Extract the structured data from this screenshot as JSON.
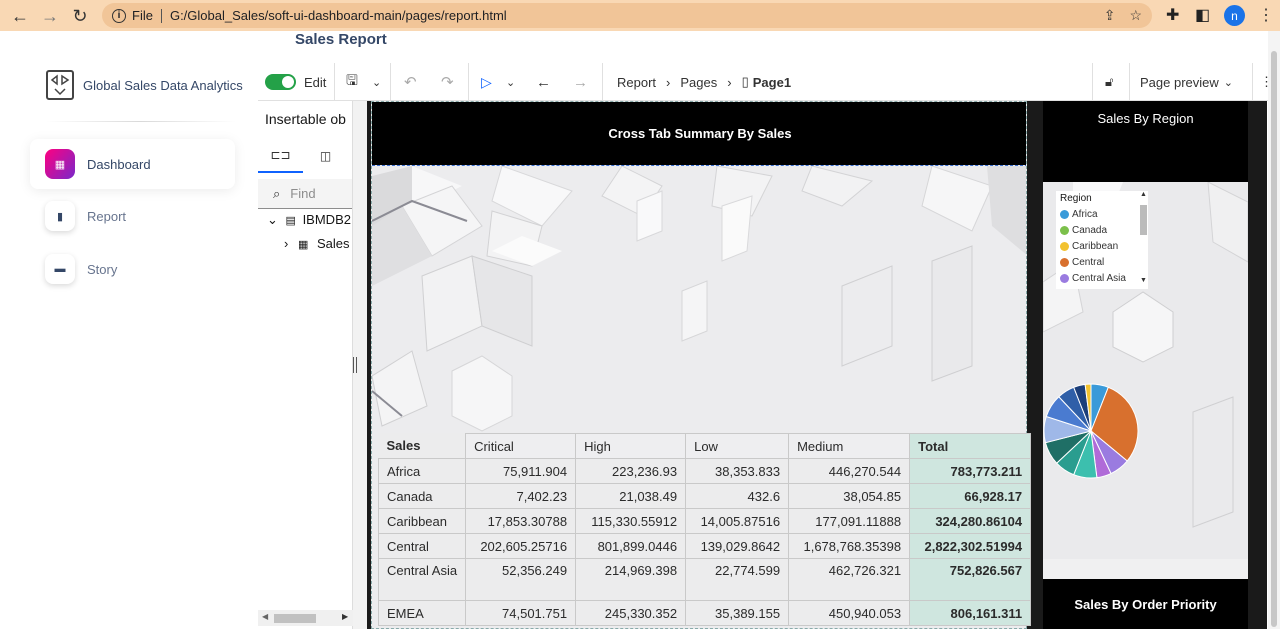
{
  "browser": {
    "url_scheme": "File",
    "url": "G:/Global_Sales/soft-ui-dashboard-main/pages/report.html",
    "avatar_letter": "n"
  },
  "page": {
    "title": "Sales Report"
  },
  "sidebar": {
    "brand": "Global Sales Data Analytics",
    "items": [
      {
        "label": "Dashboard",
        "icon": "shop-icon",
        "active": true
      },
      {
        "label": "Report",
        "icon": "chart-bar-icon",
        "active": false
      },
      {
        "label": "Story",
        "icon": "credit-card-icon",
        "active": false
      }
    ]
  },
  "toolbar": {
    "edit_label": "Edit",
    "breadcrumb": [
      "Report",
      "Pages",
      "Page1"
    ],
    "page_preview": "Page preview"
  },
  "insertable": {
    "title": "Insertable ob",
    "find_placeholder": "Find",
    "tree": [
      {
        "label": "IBMDB2",
        "icon": "database-icon",
        "expanded": true
      },
      {
        "label": "Sales",
        "icon": "table-icon",
        "expanded": false
      }
    ]
  },
  "canvas": {
    "crosstab_title": "Cross Tab Summary By Sales",
    "region_title": "Sales By Region",
    "priority_title": "Sales By Order Priority",
    "legend": {
      "title": "Region",
      "items": [
        {
          "label": "Africa",
          "color": "#3a9ad9"
        },
        {
          "label": "Canada",
          "color": "#7cc04b"
        },
        {
          "label": "Caribbean",
          "color": "#f2c230"
        },
        {
          "label": "Central",
          "color": "#d8702e"
        },
        {
          "label": "Central Asia",
          "color": "#9a7be0"
        }
      ]
    }
  },
  "crosstab": {
    "corner": "Sales",
    "columns": [
      "Critical",
      "High",
      "Low",
      "Medium",
      "Total"
    ],
    "rows": [
      {
        "label": "Africa",
        "values": [
          "75,911.904",
          "223,236.93",
          "38,353.833",
          "446,270.544",
          "783,773.211"
        ]
      },
      {
        "label": "Canada",
        "values": [
          "7,402.23",
          "21,038.49",
          "432.6",
          "38,054.85",
          "66,928.17"
        ]
      },
      {
        "label": "Caribbean",
        "values": [
          "17,853.30788",
          "115,330.55912",
          "14,005.87516",
          "177,091.11888",
          "324,280.86104"
        ]
      },
      {
        "label": "Central",
        "values": [
          "202,605.25716",
          "801,899.0446",
          "139,029.8642",
          "1,678,768.35398",
          "2,822,302.51994"
        ]
      },
      {
        "label": "Central Asia",
        "values": [
          "52,356.249",
          "214,969.398",
          "22,774.599",
          "462,726.321",
          "752,826.567"
        ]
      },
      {
        "label": "EMEA",
        "values": [
          "74,501.751",
          "245,330.352",
          "35,389.155",
          "450,940.053",
          "806,161.311"
        ]
      }
    ]
  },
  "pie": {
    "colors": [
      "#3a9ad9",
      "#d8702e",
      "#9a7be0",
      "#b06bd8",
      "#3cbfae",
      "#2a9d8f",
      "#1f6f66",
      "#9fb8e8",
      "#4a7bd0",
      "#2f5fa8",
      "#1c3f7a",
      "#f2c230"
    ],
    "values": [
      6,
      30,
      7,
      5,
      8,
      7,
      8,
      9,
      8,
      6,
      4,
      2
    ]
  }
}
